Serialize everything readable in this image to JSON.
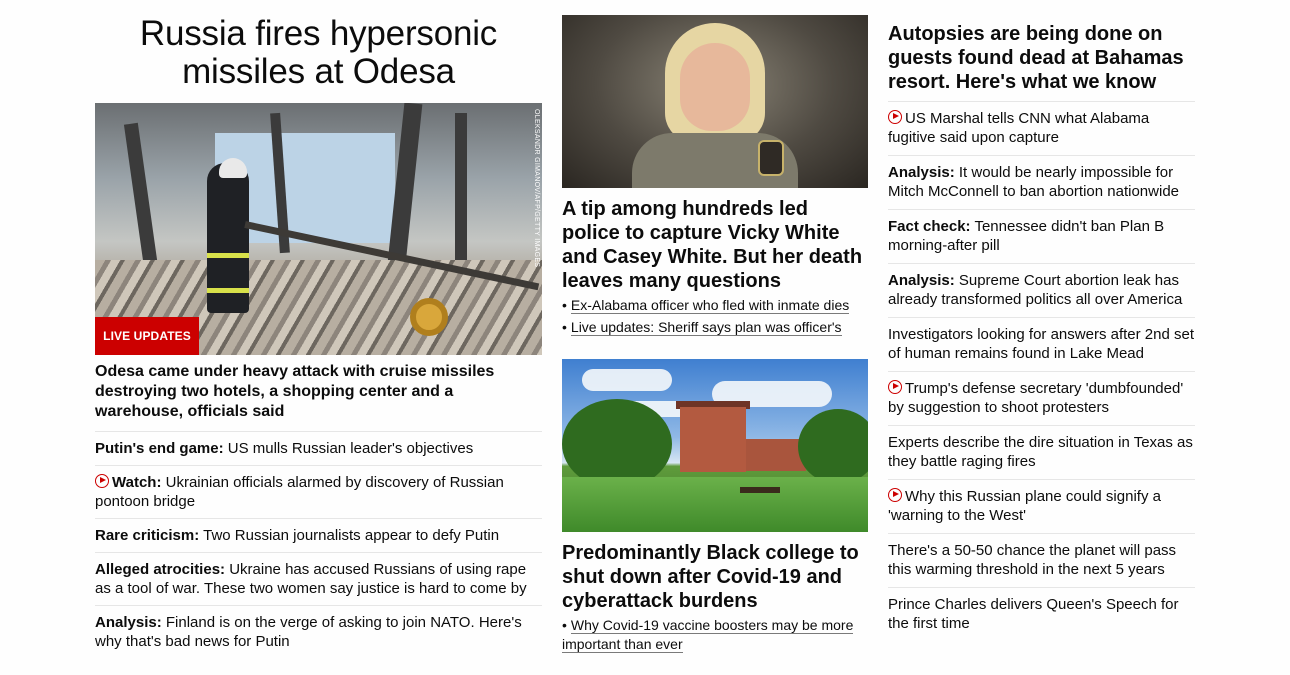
{
  "col1": {
    "title": "Russia fires hypersonic missiles at Odesa",
    "image_credit": "OLEKSANDR GIMANOV/AFP/GETTY IMAGES",
    "badge": "LIVE UPDATES",
    "lead": "Odesa came under heavy attack with cruise missiles destroying two hotels, a shopping center and a warehouse, officials said",
    "stories": [
      {
        "prefix": "Putin's end game:",
        "text": " US mulls Russian leader's objectives",
        "video": false
      },
      {
        "prefix": "Watch:",
        "text": " Ukrainian officials alarmed by discovery of Russian pontoon bridge",
        "video": true
      },
      {
        "prefix": "Rare criticism:",
        "text": " Two Russian journalists appear to defy Putin",
        "video": false
      },
      {
        "prefix": "Alleged atrocities:",
        "text": " Ukraine has accused Russians of using rape as a tool of war. These two women say justice is hard to come by",
        "video": false
      },
      {
        "prefix": "Analysis:",
        "text": " Finland is on the verge of asking to join NATO. Here's why that's bad news for Putin",
        "video": false
      }
    ]
  },
  "col2": {
    "story1": {
      "title": "A tip among hundreds led police to capture Vicky White and Casey White. But her death leaves many questions",
      "bullets": [
        "Ex-Alabama officer who fled with inmate dies",
        "Live updates: Sheriff says plan was officer's"
      ]
    },
    "story2": {
      "title": "Predominantly Black college to shut down after Covid-19 and cyberattack burdens",
      "bullets": [
        "Why Covid-19 vaccine boosters may be more important than ever"
      ]
    }
  },
  "col3": {
    "title": "Autopsies are being done on guests found dead at Bahamas resort. Here's what we know",
    "stories": [
      {
        "prefix": "",
        "text": "US Marshal tells CNN what Alabama fugitive said upon capture",
        "video": true
      },
      {
        "prefix": "Analysis:",
        "text": " It would be nearly impossible for Mitch McConnell to ban abortion nationwide",
        "video": false
      },
      {
        "prefix": "Fact check:",
        "text": " Tennessee didn't ban Plan B morning-after pill",
        "video": false
      },
      {
        "prefix": "Analysis:",
        "text": " Supreme Court abortion leak has already transformed politics all over America",
        "video": false
      },
      {
        "prefix": "",
        "text": "Investigators looking for answers after 2nd set of human remains found in Lake Mead",
        "video": false
      },
      {
        "prefix": "",
        "text": "Trump's defense secretary 'dumbfounded' by suggestion to shoot protesters",
        "video": true
      },
      {
        "prefix": "",
        "text": "Experts describe the dire situation in Texas as they battle raging fires",
        "video": false
      },
      {
        "prefix": "",
        "text": "Why this Russian plane could signify a 'warning to the West'",
        "video": true
      },
      {
        "prefix": "",
        "text": "There's a 50-50 chance the planet will pass this warming threshold in the next 5 years",
        "video": false
      },
      {
        "prefix": "",
        "text": "Prince Charles delivers Queen's Speech for the first time",
        "video": false
      }
    ]
  },
  "colors": {
    "accent_red": "#cc0000",
    "divider": "#e6e6e6",
    "text": "#0c0c0c"
  },
  "icons": {
    "video": "play-circle-icon"
  }
}
